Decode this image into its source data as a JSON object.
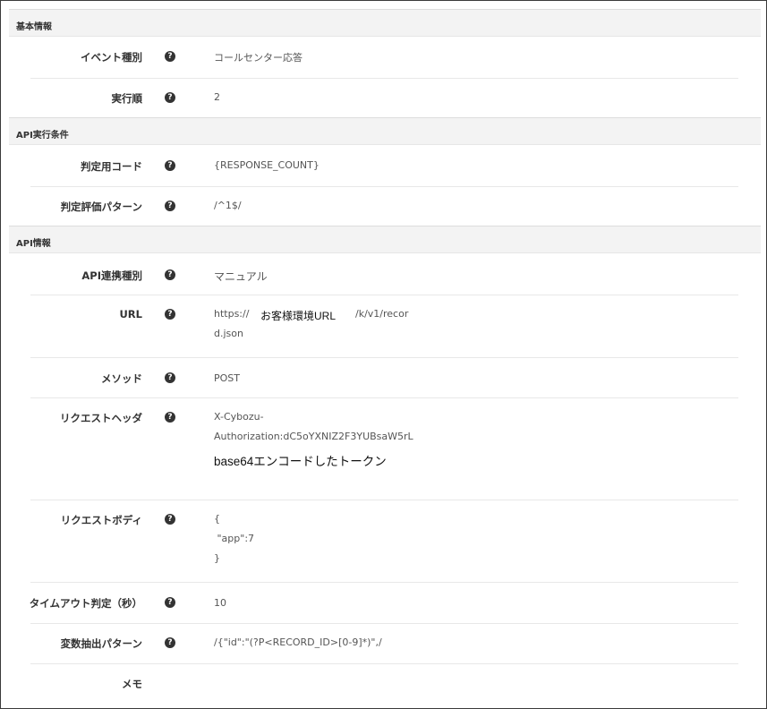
{
  "sections": {
    "basic": {
      "title": "基本情報"
    },
    "condition": {
      "title": "API実行条件"
    },
    "api": {
      "title": "API情報"
    }
  },
  "fields": {
    "event_type": {
      "label": "イベント種別",
      "value": "コールセンター応答"
    },
    "exec_order": {
      "label": "実行順",
      "value": "2"
    },
    "judge_code": {
      "label": "判定用コード",
      "value": "{RESPONSE_COUNT}"
    },
    "judge_pattern": {
      "label": "判定評価パターン",
      "value": "/^1$/"
    },
    "api_type": {
      "label": "API連携種別",
      "value": "マニュアル"
    },
    "url": {
      "label": "URL",
      "prefix": "https://",
      "annotation": "お客様環境URL",
      "suffix": "/k/v1/recor",
      "line2": "d.json"
    },
    "method": {
      "label": "メソッド",
      "value": "POST"
    },
    "request_header": {
      "label": "リクエストヘッダ",
      "line1": "X-Cybozu-",
      "line2": "Authorization:dC5oYXNIZ2F3YUBsaW5rL",
      "annotation": "base64エンコードしたトークン"
    },
    "request_body": {
      "label": "リクエストボディ",
      "lines": [
        "{",
        " \"app\":7",
        "}"
      ]
    },
    "timeout": {
      "label": "タイムアウト判定（秒）",
      "value": "10"
    },
    "var_pattern": {
      "label": "変数抽出パターン",
      "value": "/{\"id\":\"(?P<RECORD_ID>[0-9]*)\",/"
    },
    "memo": {
      "label": "メモ",
      "value": ""
    }
  },
  "icons": {
    "help": "question-circle-icon"
  }
}
